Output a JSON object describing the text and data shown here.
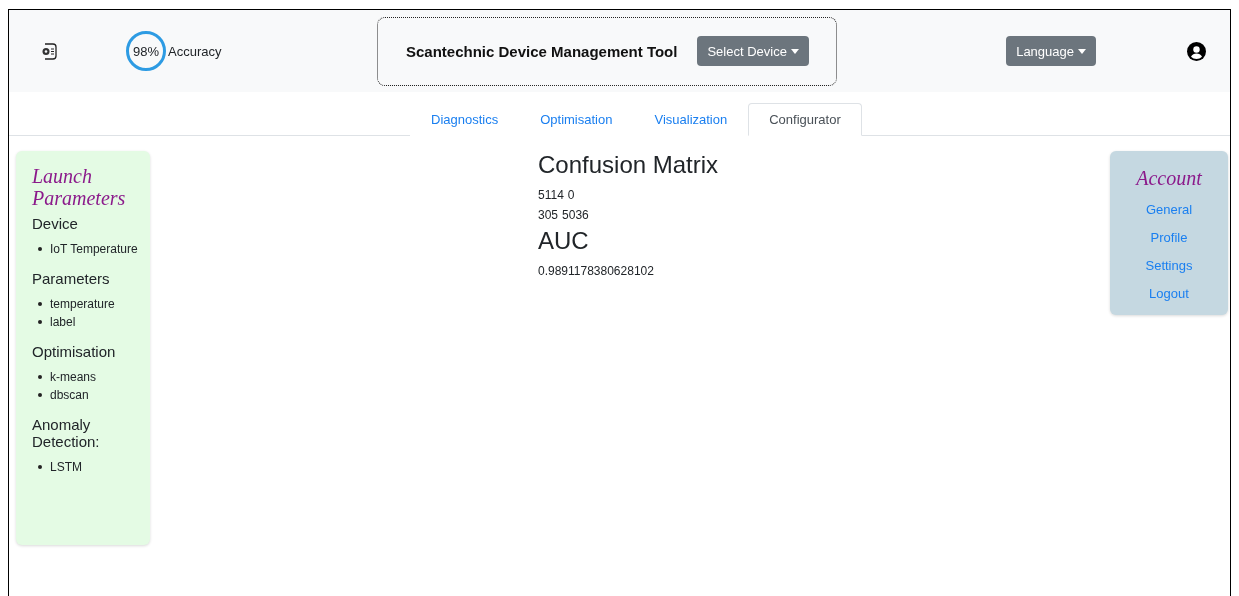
{
  "header": {
    "accuracy": {
      "value": "98%",
      "label": "Accuracy"
    },
    "title": "Scantechnic Device Management Tool",
    "device_button": "Select Device",
    "language_button": "Language"
  },
  "tabs": [
    {
      "label": "Diagnostics",
      "selected": false
    },
    {
      "label": "Optimisation",
      "selected": false
    },
    {
      "label": "Visualization",
      "selected": false
    },
    {
      "label": "Configurator",
      "selected": true
    }
  ],
  "launch_parameters": {
    "title": "Launch Parameters",
    "sections": [
      {
        "heading": "Device",
        "items": [
          "IoT Temperature"
        ]
      },
      {
        "heading": "Parameters",
        "items": [
          "temperature",
          "label"
        ]
      },
      {
        "heading": "Optimisation",
        "items": [
          "k-means",
          "dbscan"
        ]
      },
      {
        "heading": "Anomaly Detection:",
        "items": [
          "LSTM"
        ]
      }
    ]
  },
  "results": {
    "matrix_title": "Confusion Matrix",
    "matrix_rows": [
      [
        "5114",
        "0"
      ],
      [
        "305",
        "5036"
      ]
    ],
    "auc_title": "AUC",
    "auc_value": "0.9891178380628102"
  },
  "account": {
    "title": "Account",
    "links": [
      "General",
      "Profile",
      "Settings",
      "Logout"
    ]
  }
}
